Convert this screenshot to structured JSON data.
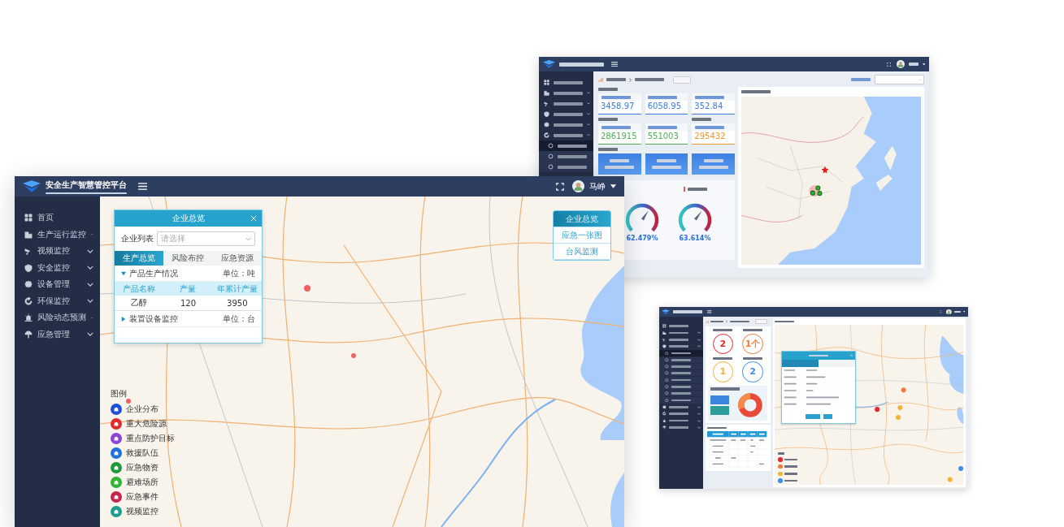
{
  "main_window": {
    "title": "安全生产智慧管控平台",
    "user": "马峥",
    "sidebar": [
      {
        "label": "首页",
        "has_submenu": false
      },
      {
        "label": "生产运行监控",
        "has_submenu": true
      },
      {
        "label": "视频监控",
        "has_submenu": true
      },
      {
        "label": "安全监控",
        "has_submenu": true
      },
      {
        "label": "设备管理",
        "has_submenu": true
      },
      {
        "label": "环保监控",
        "has_submenu": true
      },
      {
        "label": "风险动态预测",
        "has_submenu": true
      },
      {
        "label": "应急管理",
        "has_submenu": true
      }
    ],
    "enterprise_panel": {
      "title": "企业总览",
      "field": {
        "label": "企业列表",
        "placeholder": "请选择"
      },
      "tabs": [
        {
          "label": "生产总览",
          "selected": true
        },
        {
          "label": "风险布控",
          "selected": false
        },
        {
          "label": "应急资源",
          "selected": false
        }
      ],
      "sections": [
        {
          "title": "产品生产情况",
          "unit": "单位：吨",
          "expanded": true,
          "columns": [
            "产品名称",
            "产量",
            "年累计产量"
          ],
          "rows": [
            [
              "乙醇",
              "120",
              "3950"
            ]
          ]
        },
        {
          "title": "装置设备监控",
          "unit": "单位：台",
          "expanded": false
        }
      ]
    },
    "quick_menu": [
      {
        "label": "企业总览",
        "selected": true
      },
      {
        "label": "应急一张图",
        "selected": false
      },
      {
        "label": "台风监测",
        "selected": false
      }
    ],
    "legend": {
      "title": "图例",
      "items": [
        {
          "label": "企业分布",
          "color": "#1d4fd8"
        },
        {
          "label": "重大危险源",
          "color": "#e02b2b"
        },
        {
          "label": "重点防护目标",
          "color": "#8e44d6"
        },
        {
          "label": "救援队伍",
          "color": "#1e6fe0"
        },
        {
          "label": "应急物资",
          "color": "#1e9a3a"
        },
        {
          "label": "避难场所",
          "color": "#2fb52f"
        },
        {
          "label": "应急事件",
          "color": "#c8244c"
        },
        {
          "label": "视频监控",
          "color": "#1a9f8f"
        }
      ]
    }
  },
  "env_window": {
    "sidebar": [
      {
        "has_submenu": false
      },
      {
        "has_submenu": true,
        "expanded": false
      },
      {
        "has_submenu": true,
        "expanded": false
      },
      {
        "has_submenu": true,
        "expanded": false
      },
      {
        "has_submenu": true,
        "expanded": false
      },
      {
        "has_submenu": true,
        "expanded": true,
        "children": [
          {
            "selected": true
          },
          {
            "selected": false
          },
          {
            "selected": false
          }
        ]
      }
    ],
    "stat_rows": [
      {
        "groups": [
          {
            "cards": [
              {
                "kind": "stat",
                "value": "3458.97",
                "color": "#3b7de0"
              },
              {
                "kind": "stat",
                "value": "6058.95",
                "color": "#3b7de0"
              },
              {
                "kind": "stat",
                "value": "352.84",
                "color": "#3b7de0"
              }
            ]
          }
        ]
      },
      {
        "groups": [
          {
            "cards": [
              {
                "kind": "stat",
                "value": "2861915",
                "color": "#4caf50"
              },
              {
                "kind": "stat",
                "value": "551003",
                "color": "#4caf50"
              }
            ]
          },
          {
            "cards": [
              {
                "kind": "stat",
                "value": "295432",
                "color": "#f0962a"
              }
            ]
          }
        ]
      },
      {
        "groups": [
          {
            "cards": [
              {
                "kind": "performance"
              },
              {
                "kind": "performance"
              },
              {
                "kind": "performance"
              }
            ]
          }
        ]
      }
    ],
    "gauges": [
      {
        "titled": false,
        "reading": "62.479%",
        "level": 0.62479
      },
      {
        "titled": true,
        "reading": "63.614%",
        "level": 0.63614
      }
    ]
  },
  "hazard_window": {
    "sidebar": [
      {
        "has_submenu": false
      },
      {
        "has_submenu": true,
        "expanded": false
      },
      {
        "has_submenu": true,
        "expanded": false
      },
      {
        "has_submenu": true,
        "expanded": true,
        "children": [
          {
            "selected": true
          },
          {
            "selected": false
          },
          {
            "selected": false
          },
          {
            "selected": false
          },
          {
            "selected": false
          },
          {
            "selected": false
          },
          {
            "selected": false
          },
          {
            "selected": false
          }
        ]
      },
      {
        "has_submenu": true,
        "expanded": false
      },
      {
        "has_submenu": true,
        "expanded": false
      },
      {
        "has_submenu": true,
        "expanded": false
      },
      {
        "has_submenu": true,
        "expanded": false
      }
    ],
    "levels": [
      {
        "value": "2",
        "color": "#e8262c"
      },
      {
        "value": "1个",
        "color": "#f27a3a"
      },
      {
        "value": "1",
        "color": "#f5b335"
      },
      {
        "value": "2",
        "color": "#3a8ff0"
      }
    ],
    "popup_tabs": [
      {
        "selected": true
      },
      {
        "selected": false
      }
    ],
    "legend": [
      {
        "color": "#e8262c"
      },
      {
        "color": "#f27a3a"
      },
      {
        "color": "#f5b335"
      },
      {
        "color": "#3a8ff0"
      }
    ]
  }
}
